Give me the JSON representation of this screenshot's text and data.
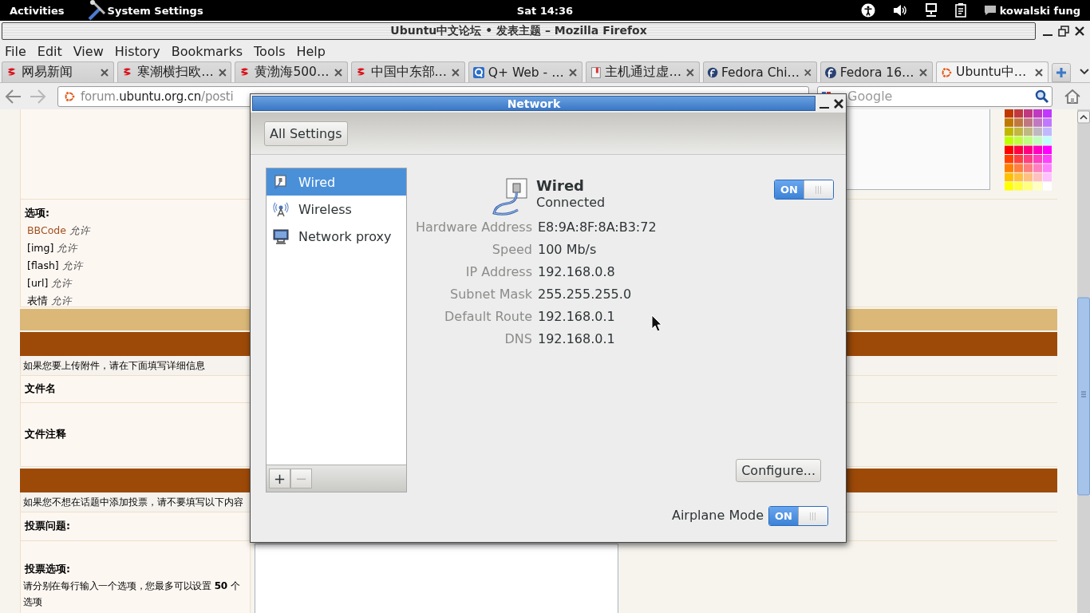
{
  "top_bar": {
    "activities": "Activities",
    "app_menu": "System Settings",
    "clock": "Sat 14:36",
    "user": "kowalski fung"
  },
  "browser": {
    "title": "Ubuntu中文论坛 • 发表主题 – Mozilla Firefox",
    "menu": [
      "File",
      "Edit",
      "View",
      "History",
      "Bookmarks",
      "Tools",
      "Help"
    ],
    "tabs": [
      {
        "label": "网易新闻",
        "kind": "news",
        "selected": false
      },
      {
        "label": "寒潮横扫欧…",
        "kind": "news",
        "selected": false
      },
      {
        "label": "黄渤海500…",
        "kind": "news",
        "selected": false
      },
      {
        "label": "中国中东部…",
        "kind": "news",
        "selected": false
      },
      {
        "label": "Q+ Web - …",
        "kind": "qq",
        "selected": false
      },
      {
        "label": "主机通过虚…",
        "kind": "doc",
        "selected": false
      },
      {
        "label": "Fedora Chi…",
        "kind": "fedora",
        "selected": false
      },
      {
        "label": "Fedora 16…",
        "kind": "fedora",
        "selected": false
      },
      {
        "label": "Ubuntu中…",
        "kind": "ubuntu",
        "selected": true
      }
    ],
    "url": {
      "subdomain": "forum.",
      "domain": "ubuntu.org.cn",
      "path": "/posti"
    },
    "search": {
      "placeholder": "Google"
    }
  },
  "page": {
    "options": {
      "title": "选项:",
      "items": [
        {
          "name": "BBCode",
          "value": "允许",
          "kind": "link"
        },
        {
          "name": "[img]",
          "value": "允许",
          "kind": "text"
        },
        {
          "name": "[flash]",
          "value": "允许",
          "kind": "text"
        },
        {
          "name": "[url]",
          "value": "允许",
          "kind": "text"
        },
        {
          "name": "表情",
          "value": "允许",
          "kind": "text"
        }
      ]
    },
    "attach_notice": "如果您要上传附件，请在下面填写详细信息",
    "file_name_label": "文件名",
    "file_comment_label": "文件注释",
    "poll_notice": "如果您不想在话题中添加投票，请不要填写以下内容",
    "poll_question_label": "投票问题:",
    "poll_options_label": "投票选项:",
    "poll_options_hint": "请分别在每行输入一个选项，您最多可以设置 **50** 个选项"
  },
  "dialog": {
    "title": "Network",
    "all_settings": "All Settings",
    "devices": [
      {
        "label": "Wired",
        "kind": "wired",
        "selected": true
      },
      {
        "label": "Wireless",
        "kind": "wireless",
        "selected": false
      },
      {
        "label": "Network proxy",
        "kind": "proxy",
        "selected": false
      }
    ],
    "add": {
      "label": "+",
      "disabled": false
    },
    "remove": {
      "label": "−",
      "disabled": true
    },
    "device": {
      "name": "Wired",
      "status": "Connected",
      "switch": {
        "label": "ON",
        "on": true
      }
    },
    "details": [
      {
        "label": "Hardware Address",
        "value": "E8:9A:8F:8A:B3:72"
      },
      {
        "label": "Speed",
        "value": "100 Mb/s"
      },
      {
        "label": "IP Address",
        "value": "192.168.0.8"
      },
      {
        "label": "Subnet Mask",
        "value": "255.255.255.0"
      },
      {
        "label": "Default Route",
        "value": "192.168.0.1"
      },
      {
        "label": "DNS",
        "value": "192.168.0.1"
      }
    ],
    "configure": "Configure...",
    "airplane": {
      "label": "Airplane Mode",
      "switch": {
        "label": "ON",
        "on": true
      }
    }
  }
}
